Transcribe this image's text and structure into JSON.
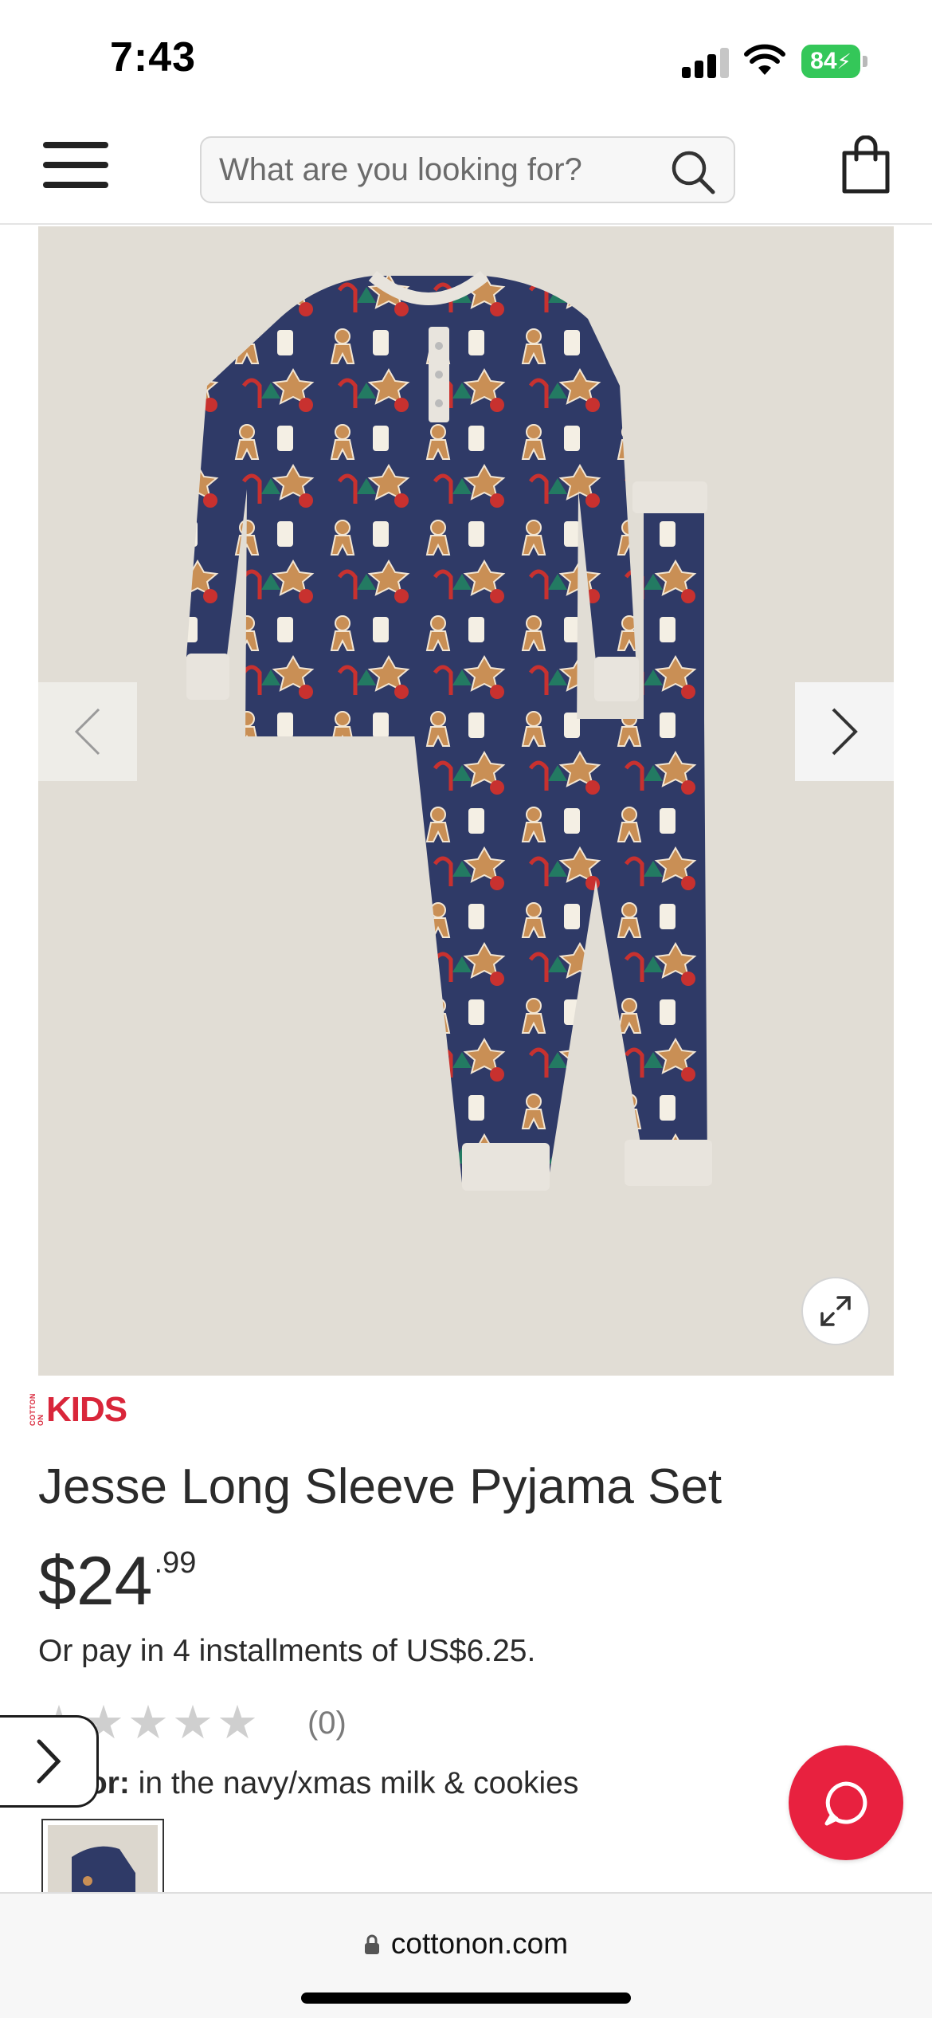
{
  "status_bar": {
    "time": "7:43",
    "battery_level": "84",
    "icons": [
      "signal-icon",
      "wifi-icon",
      "battery-charging-icon"
    ]
  },
  "header": {
    "menu_icon": "hamburger-menu-icon",
    "search": {
      "placeholder": "What are you looking for?",
      "value": ""
    },
    "search_icon": "search-icon",
    "bag_icon": "shopping-bag-icon"
  },
  "gallery": {
    "prev_icon": "chevron-left-icon",
    "next_icon": "chevron-right-icon",
    "expand_icon": "expand-icon",
    "colors": {
      "background": "#e1ddd5",
      "fabric": "#2f3a67",
      "cuffs": "#e8e4dd"
    }
  },
  "product": {
    "brand": "KIDS",
    "brand_small": "COTTON ON",
    "title": "Jesse Long Sleeve Pyjama Set",
    "price_dollars": "$24",
    "price_cents": ".99",
    "installments": "Or pay in 4 installments of US$6.25.",
    "rating_stars": "★★★★★",
    "rating_value": 0,
    "rating_count": "(0)",
    "color_label": "Color:",
    "color_value": "in the navy/xmas milk & cookies",
    "color_label_visible": "or:"
  },
  "floating": {
    "side_toggle_icon": "chevron-right-icon",
    "chat_icon": "chat-bubble-icon",
    "chat_color": "#e8213f"
  },
  "browser": {
    "url": "cottonon.com",
    "lock_icon": "lock-icon"
  },
  "colors": {
    "brand_red": "#d9263a",
    "text": "#2b2b2b"
  }
}
